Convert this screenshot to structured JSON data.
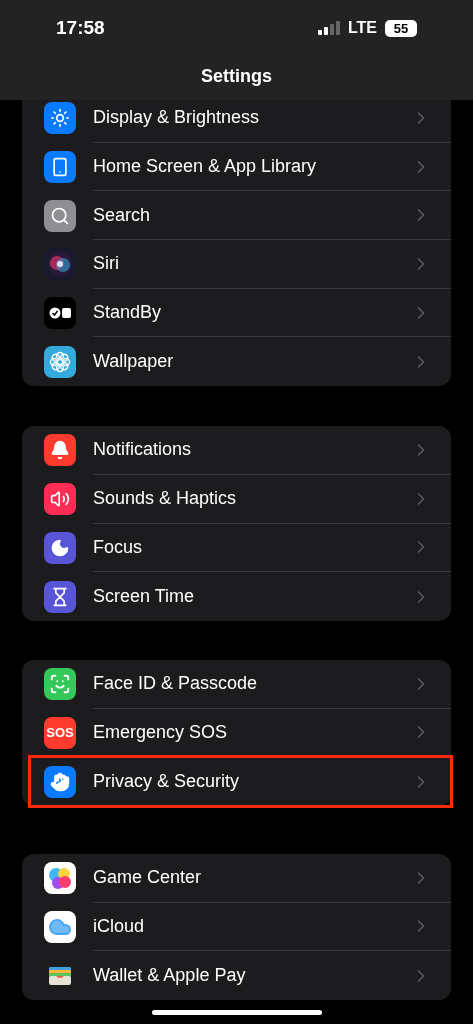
{
  "status_bar": {
    "time": "17:58",
    "network": "LTE",
    "battery": "55"
  },
  "title": "Settings",
  "groups": [
    {
      "items": [
        {
          "kind": "display",
          "label": "Display & Brightness",
          "highlighted": false
        },
        {
          "kind": "home-screen",
          "label": "Home Screen & App Library",
          "highlighted": false
        },
        {
          "kind": "search",
          "label": "Search",
          "highlighted": false
        },
        {
          "kind": "siri",
          "label": "Siri",
          "highlighted": false
        },
        {
          "kind": "standby",
          "label": "StandBy",
          "highlighted": false
        },
        {
          "kind": "wallpaper",
          "label": "Wallpaper",
          "highlighted": false
        }
      ]
    },
    {
      "items": [
        {
          "kind": "notifications",
          "label": "Notifications",
          "highlighted": false
        },
        {
          "kind": "sounds",
          "label": "Sounds & Haptics",
          "highlighted": false
        },
        {
          "kind": "focus",
          "label": "Focus",
          "highlighted": false
        },
        {
          "kind": "screen-time",
          "label": "Screen Time",
          "highlighted": false
        }
      ]
    },
    {
      "items": [
        {
          "kind": "face-id",
          "label": "Face ID & Passcode",
          "highlighted": false
        },
        {
          "kind": "sos",
          "label": "Emergency SOS",
          "icon_text": "SOS",
          "highlighted": false
        },
        {
          "kind": "privacy",
          "label": "Privacy & Security",
          "highlighted": true
        }
      ]
    },
    {
      "items": [
        {
          "kind": "game-center",
          "label": "Game Center",
          "highlighted": false
        },
        {
          "kind": "icloud",
          "label": "iCloud",
          "highlighted": false
        },
        {
          "kind": "wallet",
          "label": "Wallet & Apple Pay",
          "highlighted": false
        }
      ]
    }
  ]
}
